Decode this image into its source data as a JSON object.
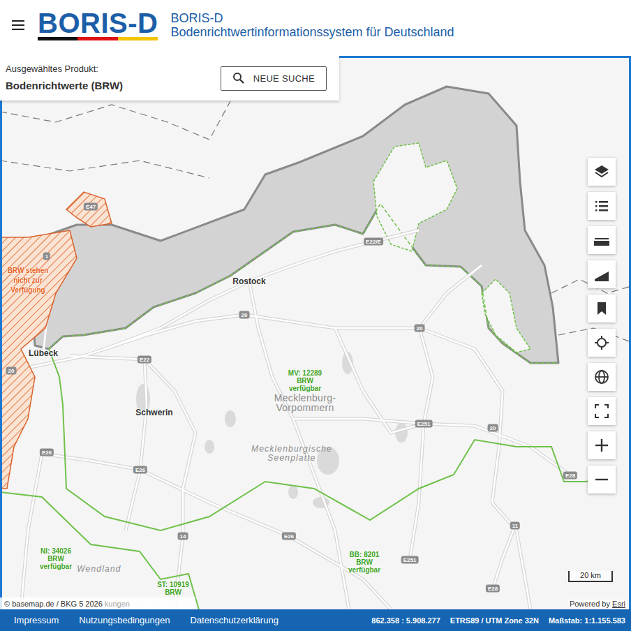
{
  "header": {
    "logo": "BORIS-D",
    "title": "BORIS-D",
    "subtitle": "Bodenrichtwertinformationssystem für Deutschland"
  },
  "product_panel": {
    "label": "Ausgewähltes Produkt:",
    "value": "Bodenrichtwerte (BRW)",
    "button": "NEUE SUCHE"
  },
  "map": {
    "labels": [
      {
        "kind": "road",
        "lines": [
          "E47"
        ]
      },
      {
        "kind": "road",
        "lines": [
          "1"
        ]
      },
      {
        "kind": "road",
        "lines": [
          "20"
        ]
      },
      {
        "kind": "road",
        "lines": [
          "E22"
        ]
      },
      {
        "kind": "road",
        "lines": [
          "E22/E"
        ]
      },
      {
        "kind": "road",
        "lines": [
          "20"
        ]
      },
      {
        "kind": "road",
        "lines": [
          "20"
        ]
      },
      {
        "kind": "road",
        "lines": [
          "E26"
        ]
      },
      {
        "kind": "road",
        "lines": [
          "E26"
        ]
      },
      {
        "kind": "road",
        "lines": [
          "14"
        ]
      },
      {
        "kind": "road",
        "lines": [
          "E26"
        ]
      },
      {
        "kind": "road",
        "lines": [
          "E251"
        ]
      },
      {
        "kind": "road",
        "lines": [
          "E251"
        ]
      },
      {
        "kind": "road",
        "lines": [
          "20"
        ]
      },
      {
        "kind": "road",
        "lines": [
          "11"
        ]
      },
      {
        "kind": "road",
        "lines": [
          "E28"
        ]
      },
      {
        "kind": "road",
        "lines": [
          "E28"
        ]
      },
      {
        "kind": "city",
        "lines": [
          "Rostock"
        ]
      },
      {
        "kind": "city",
        "lines": [
          "Lübeck"
        ]
      },
      {
        "kind": "city",
        "lines": [
          "Schwerin"
        ]
      },
      {
        "kind": "region",
        "lines": [
          "Mecklenburg-",
          "Vorpommern"
        ]
      },
      {
        "kind": "landscape",
        "lines": [
          "Mecklenburgische",
          "Seenplatte"
        ]
      },
      {
        "kind": "landscape",
        "lines": [
          "Wendland"
        ]
      },
      {
        "kind": "available",
        "lines": [
          "MV: 12289",
          "BRW",
          "verfügbar"
        ]
      },
      {
        "kind": "available",
        "lines": [
          "NI: 34026",
          "BRW",
          "verfügbar"
        ]
      },
      {
        "kind": "available",
        "lines": [
          "BB: 8201",
          "BRW",
          "verfügbar"
        ]
      },
      {
        "kind": "available",
        "lines": [
          "ST: 10919",
          "BRW"
        ]
      },
      {
        "kind": "unavailable",
        "lines": [
          "BRW stehen",
          "nicht zur",
          "Verfügung"
        ]
      }
    ],
    "scale": "20 km",
    "attribution": "© basemap.de / BKG 5 2026",
    "faded": "kungen",
    "powered_by": {
      "prefix": "Powered by",
      "link": "Esri"
    }
  },
  "footer": {
    "links": [
      "Impressum",
      "Nutzungsbedingungen",
      "Datenschutzerklärung"
    ],
    "coordinates": "862.358 : 5.908.277",
    "crs": "ETRS89 / UTM Zone 32N",
    "scale": "Maßstab: 1:1.155.583"
  }
}
